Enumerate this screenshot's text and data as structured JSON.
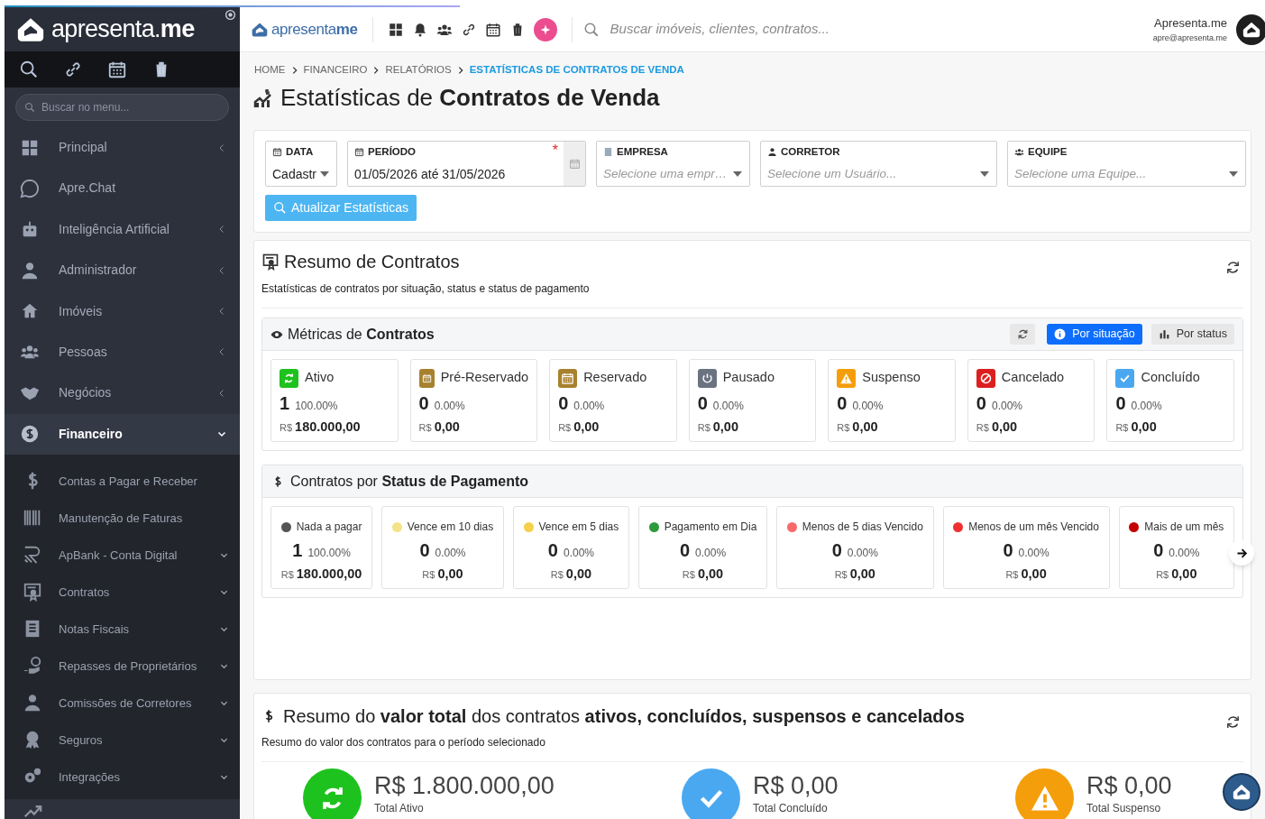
{
  "page_load": {
    "level": 0.36
  },
  "sidebar": {
    "logo": "apresenta.**me**",
    "search_placeholder": "Buscar no menu...",
    "items": [
      {
        "label": "Principal",
        "submenu": true,
        "expanded": false,
        "selected": false
      },
      {
        "label": "Apre.Chat",
        "submenu": false,
        "expanded": false,
        "selected": false
      },
      {
        "label": "Inteligência Artificial",
        "submenu": true,
        "expanded": false,
        "selected": false
      },
      {
        "label": "Administrador",
        "submenu": true,
        "expanded": false,
        "selected": false
      },
      {
        "label": "Imóveis",
        "submenu": true,
        "expanded": false,
        "selected": false
      },
      {
        "label": "Pessoas",
        "submenu": true,
        "expanded": false,
        "selected": false
      },
      {
        "label": "Negócios",
        "submenu": true,
        "expanded": false,
        "selected": false
      },
      {
        "label": "Financeiro",
        "submenu": true,
        "expanded": true,
        "selected": true,
        "children": [
          {
            "label": "Contas a Pagar e Receber",
            "submenu": false
          },
          {
            "label": "Manutenção de Faturas",
            "submenu": false
          },
          {
            "label": "ApBank - Conta Digital",
            "submenu": true
          },
          {
            "label": "Contratos",
            "submenu": true
          },
          {
            "label": "Notas Fiscais",
            "submenu": true
          },
          {
            "label": "Repasses de Proprietários",
            "submenu": true
          },
          {
            "label": "Comissões de Corretores",
            "submenu": true
          },
          {
            "label": "Seguros",
            "submenu": true
          },
          {
            "label": "Integrações",
            "submenu": true
          }
        ]
      }
    ]
  },
  "header": {
    "logo": "apresenta**me**",
    "search_placeholder": "Buscar imóveis, clientes, contratos...",
    "user_name": "Apresenta.me",
    "user_email": "apre@apresenta.me"
  },
  "breadcrumb": [
    {
      "label": "HOME",
      "selected": false
    },
    {
      "label": "FINANCEIRO",
      "selected": false
    },
    {
      "label": "RELATÓRIOS",
      "selected": false
    },
    {
      "label": "ESTATÍSTICAS DE CONTRATOS DE VENDA",
      "selected": true
    }
  ],
  "page_title": "Estatísticas de **Contratos de Venda**",
  "filters": [
    {
      "kind": "select",
      "label": "DATA",
      "value": "Cadastr"
    },
    {
      "kind": "date",
      "label": "PERÍODO",
      "value": "01/05/2026 até 31/05/2026",
      "required_mark": "*"
    },
    {
      "kind": "select",
      "label": "EMPRESA",
      "placeholder": "Selecione uma empr…"
    },
    {
      "kind": "select",
      "label": "CORRETOR",
      "placeholder": "Selecione um Usuário..."
    },
    {
      "kind": "select",
      "label": "EQUIPE",
      "placeholder": "Selecione uma Equipe..."
    }
  ],
  "update_button": "Atualizar Estatísticas",
  "summary": {
    "title": "Resumo de Contratos",
    "subtitle": "Estatísticas de contratos por situação, status e status de pagamento",
    "metrics_title": "Métricas de **Contratos**",
    "view_tabs": [
      {
        "label": "Por situação",
        "selected": true
      },
      {
        "label": "Por status",
        "selected": false
      }
    ],
    "statuses": [
      {
        "label": "Ativo",
        "count": "1",
        "percent": "100.00%",
        "currency": "R$",
        "amount": "180.000,00",
        "color": "#1ec21e"
      },
      {
        "label": "Pré-Reservado",
        "count": "0",
        "percent": "0.00%",
        "currency": "R$",
        "amount": "0,00",
        "color": "#a8812f"
      },
      {
        "label": "Reservado",
        "count": "0",
        "percent": "0.00%",
        "currency": "R$",
        "amount": "0,00",
        "color": "#a8812f"
      },
      {
        "label": "Pausado",
        "count": "0",
        "percent": "0.00%",
        "currency": "R$",
        "amount": "0,00",
        "color": "#6b7280"
      },
      {
        "label": "Suspenso",
        "count": "0",
        "percent": "0.00%",
        "currency": "R$",
        "amount": "0,00",
        "color": "#f59e0b"
      },
      {
        "label": "Cancelado",
        "count": "0",
        "percent": "0.00%",
        "currency": "R$",
        "amount": "0,00",
        "color": "#dc1f1f"
      },
      {
        "label": "Concluído",
        "count": "0",
        "percent": "0.00%",
        "currency": "R$",
        "amount": "0,00",
        "color": "#4aa8f0"
      }
    ],
    "payment_title": "Contratos por **Status de Pagamento**",
    "payments": [
      {
        "label": "Nada a pagar",
        "count": "1",
        "percent": "100.00%",
        "currency": "R$",
        "amount": "180.000,00",
        "color": "#555555"
      },
      {
        "label": "Vence em 10 dias",
        "count": "0",
        "percent": "0.00%",
        "currency": "R$",
        "amount": "0,00",
        "color": "#f5e38a"
      },
      {
        "label": "Vence em 5 dias",
        "count": "0",
        "percent": "0.00%",
        "currency": "R$",
        "amount": "0,00",
        "color": "#f5d04a"
      },
      {
        "label": "Pagamento em Dia",
        "count": "0",
        "percent": "0.00%",
        "currency": "R$",
        "amount": "0,00",
        "color": "#2e9a3a"
      },
      {
        "label": "Menos de 5 dias Vencido",
        "count": "0",
        "percent": "0.00%",
        "currency": "R$",
        "amount": "0,00",
        "color": "#f86a6a"
      },
      {
        "label": "Menos de um mês Vencido",
        "count": "0",
        "percent": "0.00%",
        "currency": "R$",
        "amount": "0,00",
        "color": "#f03030"
      },
      {
        "label": "Mais de um mês",
        "count": "0",
        "percent": "0.00%",
        "currency": "R$",
        "amount": "0,00",
        "color": "#c40000"
      }
    ]
  },
  "totals": {
    "title": "Resumo do **valor total** dos contratos **ativos, concluídos, suspensos e cancelados**",
    "subtitle": "Resumo do valor dos contratos para o período selecionado",
    "items": [
      {
        "value": "R$ 1.800.000,00",
        "label": "Total Ativo",
        "color": "#1ec21e"
      },
      {
        "value": "R$ 0,00",
        "label": "Total Concluído",
        "color": "#4aa8f0"
      },
      {
        "value": "R$ 0,00",
        "label": "Total Suspenso",
        "color": "#f59e0b"
      }
    ]
  }
}
